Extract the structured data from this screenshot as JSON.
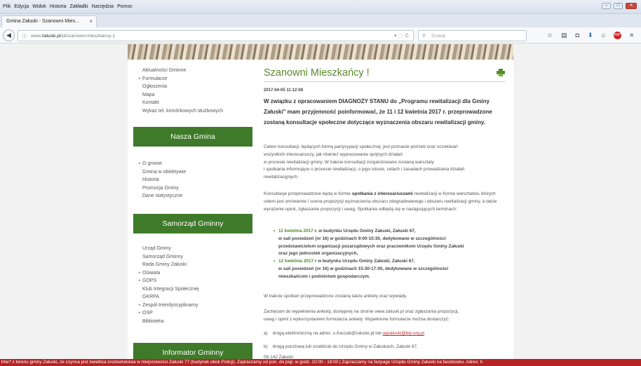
{
  "browser": {
    "menus": [
      "Plik",
      "Edycja",
      "Widok",
      "Historia",
      "Zakładki",
      "Narzędzia",
      "Pomoc"
    ],
    "tab_title": "Gmina Załuski - Szanowni Mies...",
    "url_prefix": "www.",
    "url_domain": "zaluski.pl",
    "url_path": "/pl/szanowni-mieszkancy-1",
    "search_placeholder": "Szukaj"
  },
  "sidebar": {
    "top_items": [
      "Aktualności Gminne",
      "Formularze",
      "Ogłoszenia",
      "Mapa",
      "Kontakt",
      "Wykaz tel. komórkowych służbowych"
    ],
    "section1": "Nasza Gmina",
    "section1_items": [
      "O gminie",
      "Gmina w obiektywie",
      "Historia",
      "Promocja Gminy",
      "Dane statystyczne"
    ],
    "section2": "Samorząd Gminny",
    "section2_items": [
      "Urząd Gminy",
      "Samorząd Gminny",
      "Rada Gminy Załuski",
      "Oświata",
      "GOPS",
      "Klub Integracji Społecznej",
      "GKRPA",
      "Zespół Interdyscyplinarny",
      "OSP",
      "Biblioteka"
    ],
    "section3": "Informator Gminny"
  },
  "article": {
    "title": "Szanowni Mieszkańcy !",
    "date": "2017-04-05 11:12:08",
    "lead": "W związku z opracowaniem DIAGNOZY STANU do „Programu rewitalizacji dla Gminy Załuski\" mam przyjemność poinformować, że 11 i 12 kwietnia 2017 r. przeprowadzone zostaną konsultacje społeczne dotyczące wyznaczenia obszaru rewitalizacji gminy.",
    "p1_line1": "Celem konsultacji, będących formą partycypacji społecznej, jest poznanie potrzeb oraz oczekiwań",
    "p1_line2": "wszystkich interesariuszy, jak również wypracowanie spójnych działań",
    "p1_line3": "w procesie rewitalizacji gminy. W trakcie konsultacji zorganizowane zostaną warsztaty",
    "p1_line4": "i spotkania informujące o procesie rewitalizacji, o jego istocie, celach i zasadach prowadzania działań",
    "p1_line5": "rewitalizacyjnych.",
    "p2_start": "Konsultacje przeprowadzone będą w formie ",
    "p2_bold": "spotkania z interesariuszami",
    "p2_end": " rewitalizacji w formie warsztatów, których celem jest omówienie i ocena propozycji wyznaczenia obszaru zdegradowanego i obszaru rewitalizacji gminy, a także wyrażenie opinii, zgłaszanie propozycji i uwag. Spotkania odbędą się w następujących terminach:",
    "b1_date": "11 kwietnia 2017",
    "b1_rest": " r. w budynku Urzędu Gminy Załuski, Załuski 67,",
    "b1_line2": "w sali posiedzeń (nr 16) w godzinach 9:00-10:30, dedykowane w szczególności",
    "b1_line3": "przedstawicielom organizacji pozarządowych oraz pracownikom Urzędu Gminy Załuski",
    "b1_line4": "oraz jego jednostek organizacyjnych,",
    "b2_date": "12 kwietnia 2017",
    "b2_rest": " r w budynku Urzędu Gminy Załuski, Załuski 67,",
    "b2_line2": "w sali posiedzeń (nr 16) w godzinach 15:30-17:00, dedykowane w szczególności",
    "b2_line3": "mieszkańcom i podmiotom gospodarczym.",
    "p3": "W trakcie spotkań przeprowadzone zostaną także ankiety oraz wywiady.",
    "p4_line1": "Zachęcam do wypełnienia ankiety, dostępnej na stronie www.zaluski.pl oraz zgłaszania propozycji,",
    "p4_line2": "uwag i opinii z wykorzystaniem formularza ankiety. Wypełnione formularze można dostarczyć:",
    "a_label": "a)",
    "a_text": "drogą elektroniczną na adres: u.fraczak@zaluski.pl lub ",
    "a_link": "ugzaluski@bip.org.pl",
    "b_label": "b)",
    "b_text": "drogą pocztową lub osobiście do Urzędu Gminy w Załuskach, Załuski 67,",
    "addr": "09-142 Załuski"
  },
  "ticker": "łrtie? z terenu gminy Załuski, że czynna jest świetlica środowiskowa w miejscowości Załuski 77 (budynek obok Policji). Zapraszamy od pon. do piąt. w godz. 10:00 - 18:00       |      Zapraszamy na fanpage Urzędu Gminy Załuski na facebooku. Adres: h"
}
